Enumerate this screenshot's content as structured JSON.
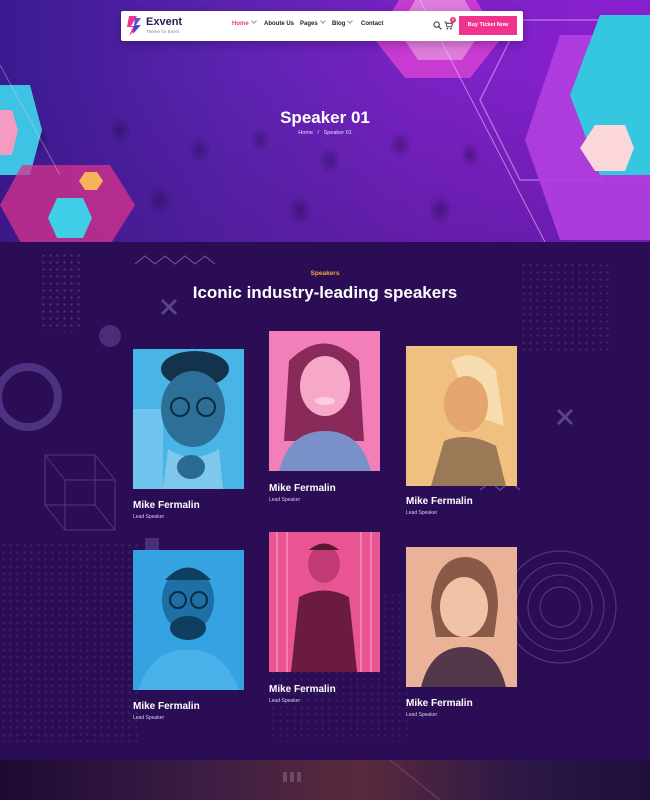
{
  "nav": {
    "logo_title": "Exvent",
    "logo_tagline": "Theme for Event",
    "items": [
      {
        "label": "Home",
        "has_dropdown": true,
        "active": true
      },
      {
        "label": "Aboute Us",
        "has_dropdown": false,
        "active": false
      },
      {
        "label": "Pages",
        "has_dropdown": true,
        "active": false
      },
      {
        "label": "Blog",
        "has_dropdown": true,
        "active": false
      },
      {
        "label": "Contact",
        "has_dropdown": false,
        "active": false
      }
    ],
    "cart_count": "0",
    "cta_label": "Buy Ticket Now"
  },
  "hero": {
    "title": "Speaker 01",
    "breadcrumb": {
      "home": "Home",
      "separator": "/",
      "current": "Speaker 01"
    }
  },
  "section": {
    "eyebrow": "Speakers",
    "heading": "Iconic industry-leading speakers"
  },
  "speakers": [
    {
      "name": "Mike Fermalin",
      "role": "Lead Speaker",
      "tint": "#3fa9e0"
    },
    {
      "name": "Mike Fermalin",
      "role": "Lead Speaker",
      "tint": "#f06aa8"
    },
    {
      "name": "Mike Fermalin",
      "role": "Lead Speaker",
      "tint": "#e8b878"
    },
    {
      "name": "Mike Fermalin",
      "role": "Lead Speaker",
      "tint": "#2f9ee0"
    },
    {
      "name": "Mike Fermalin",
      "role": "Lead Speaker",
      "tint": "#e0407e"
    },
    {
      "name": "Mike Fermalin",
      "role": "Lead Speaker",
      "tint": "#e6a98a"
    }
  ],
  "colors": {
    "accent": "#f0338d",
    "eyebrow": "#f7a43a",
    "section_bg": "#2b0d55",
    "hero_start": "#3a1a8f",
    "hero_end": "#8a1fd0"
  }
}
